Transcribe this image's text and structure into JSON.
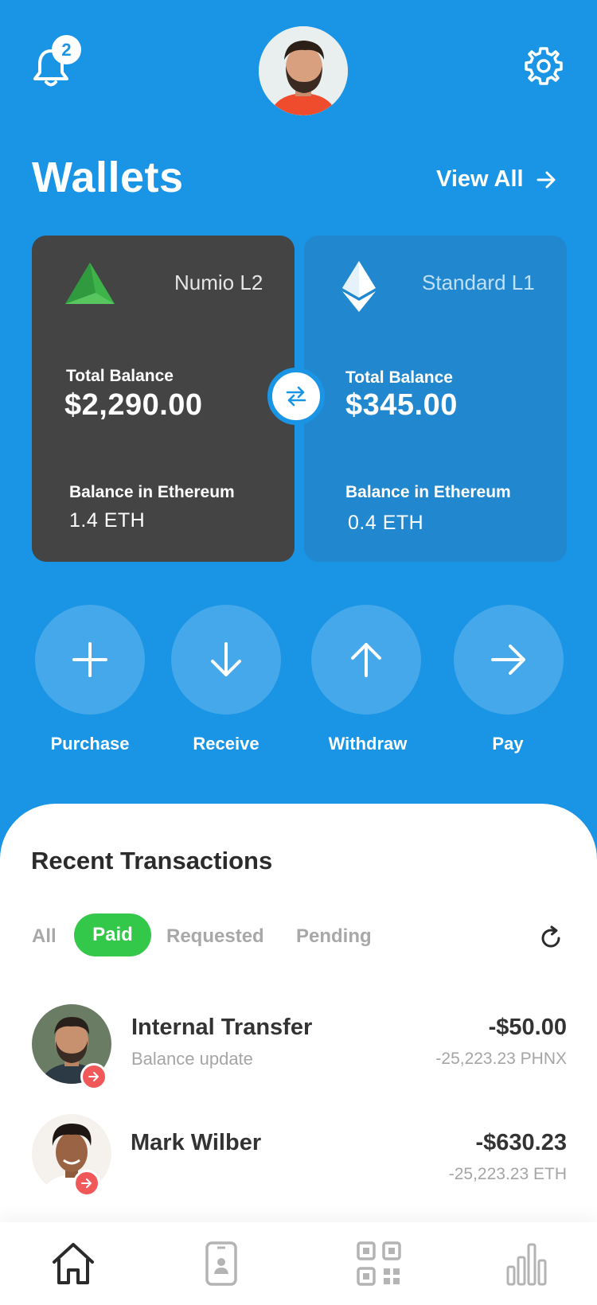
{
  "header": {
    "notification_count": "2",
    "icons": {
      "notifications": "bell-icon",
      "settings": "gear-icon"
    }
  },
  "wallets": {
    "title": "Wallets",
    "view_all_label": "View All",
    "cards": [
      {
        "network": "Numio L2",
        "icon": "numio-logo",
        "total_balance_label": "Total Balance",
        "total_balance": "$2,290.00",
        "eth_label": "Balance in Ethereum",
        "eth_balance": "1.4 ETH"
      },
      {
        "network": "Standard L1",
        "icon": "ethereum-logo",
        "total_balance_label": "Total Balance",
        "total_balance": "$345.00",
        "eth_label": "Balance in Ethereum",
        "eth_balance": "0.4 ETH"
      }
    ]
  },
  "actions": [
    {
      "label": "Purchase",
      "icon": "plus-icon"
    },
    {
      "label": "Receive",
      "icon": "arrow-down-icon"
    },
    {
      "label": "Withdraw",
      "icon": "arrow-up-icon"
    },
    {
      "label": "Pay",
      "icon": "arrow-right-icon"
    }
  ],
  "transactions": {
    "title": "Recent Transactions",
    "filters": [
      "All",
      "Paid",
      "Requested",
      "Pending"
    ],
    "active_filter": "Paid",
    "items": [
      {
        "name": "Internal Transfer",
        "subtitle": "Balance update",
        "amount": "-$50.00",
        "crypto_amount": "-25,223.23 PHNX"
      },
      {
        "name": "Mark Wilber",
        "subtitle": "",
        "amount": "-$630.23",
        "crypto_amount": "-25,223.23 ETH"
      }
    ]
  },
  "tabbar": {
    "items": [
      "home-icon",
      "contact-icon",
      "qr-code-icon",
      "stats-icon"
    ],
    "active": "home-icon"
  },
  "colors": {
    "primary": "#1a94e4",
    "dark_card": "#444444",
    "light_card": "#2188d0",
    "paid_green": "#34c84a",
    "outgoing_red": "#f0585a"
  }
}
